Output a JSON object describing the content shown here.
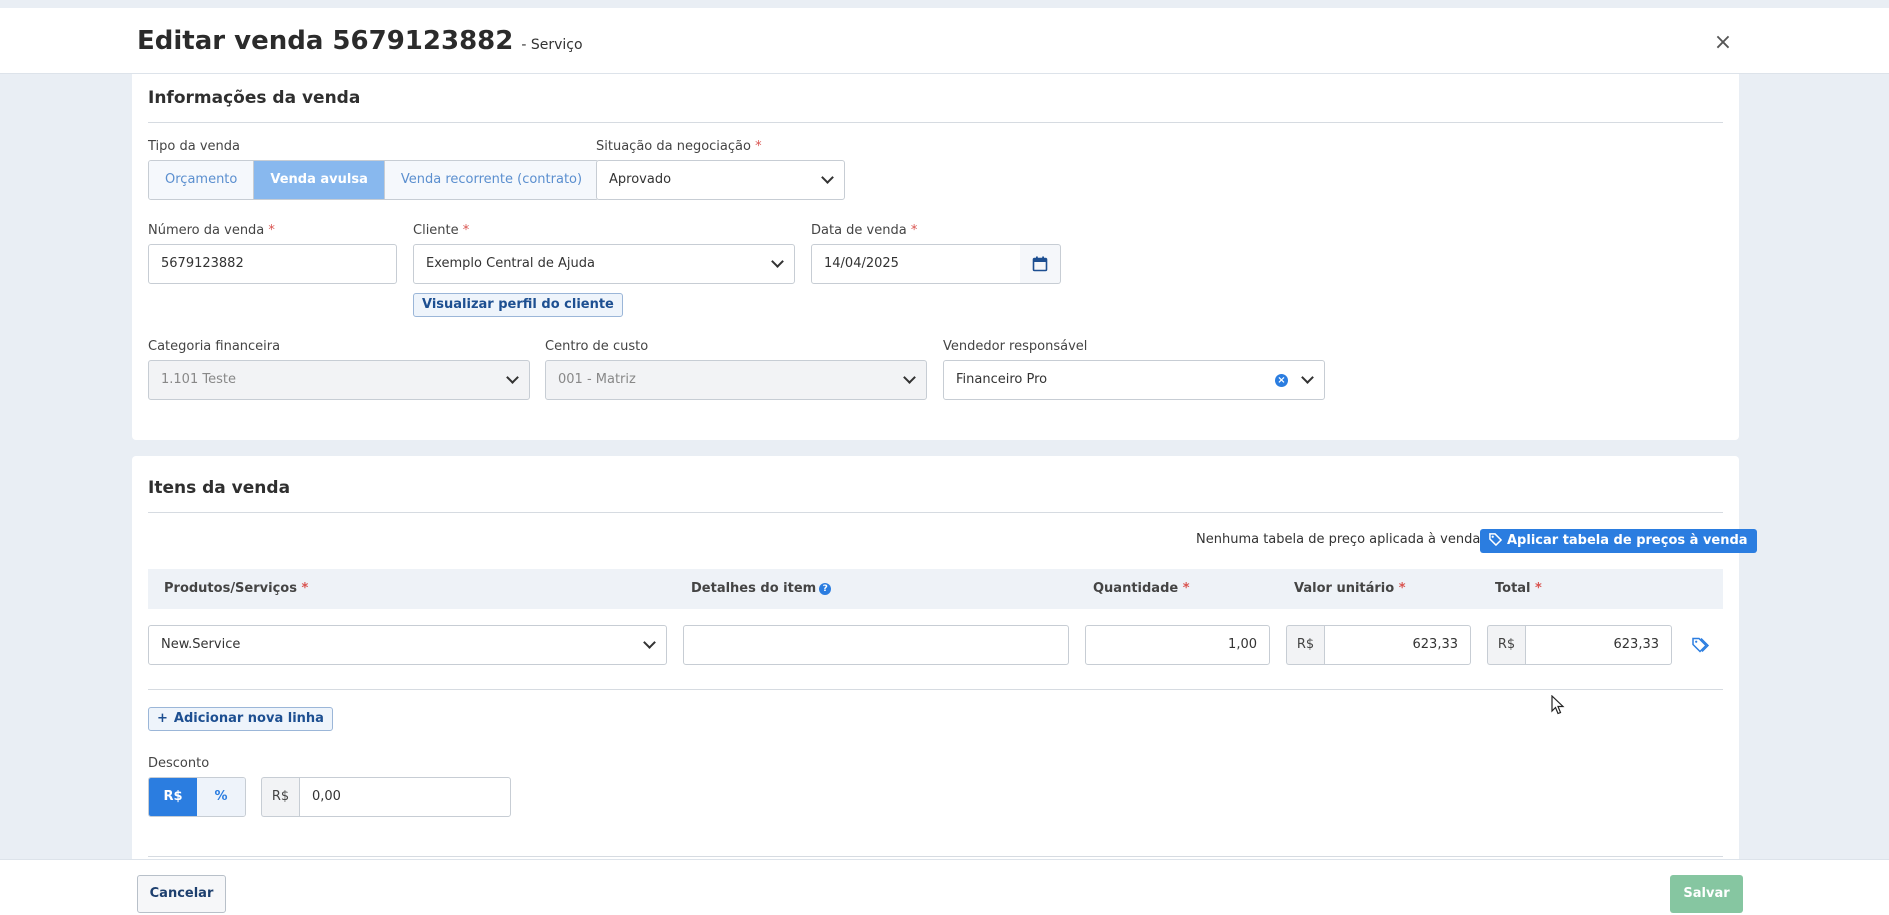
{
  "header": {
    "title": "Editar venda 5679123882",
    "subtitle": "- Serviço",
    "close_icon": "×"
  },
  "info": {
    "title": "Informações da venda",
    "sale_type_label": "Tipo da venda",
    "sale_type_options": [
      "Orçamento",
      "Venda avulsa",
      "Venda recorrente (contrato)"
    ],
    "sale_type_selected": "Venda avulsa",
    "negotiation_label": "Situação da negociação",
    "negotiation_value": "Aprovado",
    "sale_number_label": "Número da venda",
    "sale_number_value": "5679123882",
    "client_label": "Cliente",
    "client_value": "Exemplo Central de Ajuda",
    "client_profile_link": "Visualizar perfil do cliente",
    "sale_date_label": "Data de venda",
    "sale_date_value": "14/04/2025",
    "category_label": "Categoria financeira",
    "category_value": "1.101 Teste",
    "cost_center_label": "Centro de custo",
    "cost_center_value": "001 - Matriz",
    "seller_label": "Vendedor responsável",
    "seller_value": "Financeiro Pro",
    "required_mark": "*"
  },
  "items": {
    "title": "Itens da venda",
    "price_table_note": "Nenhuma tabela de preço aplicada à venda.",
    "apply_price_table_button": "Aplicar tabela de preços à venda",
    "columns": {
      "product": "Produtos/Serviços",
      "details": "Detalhes do item",
      "quantity": "Quantidade",
      "unit_value": "Valor unitário",
      "total": "Total"
    },
    "rows": [
      {
        "product": "New.Service",
        "details": "",
        "quantity": "1,00",
        "currency": "R$",
        "unit_value": "623,33",
        "total": "623,33"
      }
    ],
    "add_line_button": "Adicionar nova linha",
    "discount_label": "Desconto",
    "discount_options": [
      "R$",
      "%"
    ],
    "discount_selected": "R$",
    "discount_currency": "R$",
    "discount_value": "0,00"
  },
  "footer": {
    "cancel": "Cancelar",
    "save": "Salvar"
  },
  "colors": {
    "primary": "#2b7de0",
    "save": "#86c6a1",
    "active_segment": "#88b8ee",
    "required": "#d9534f"
  }
}
